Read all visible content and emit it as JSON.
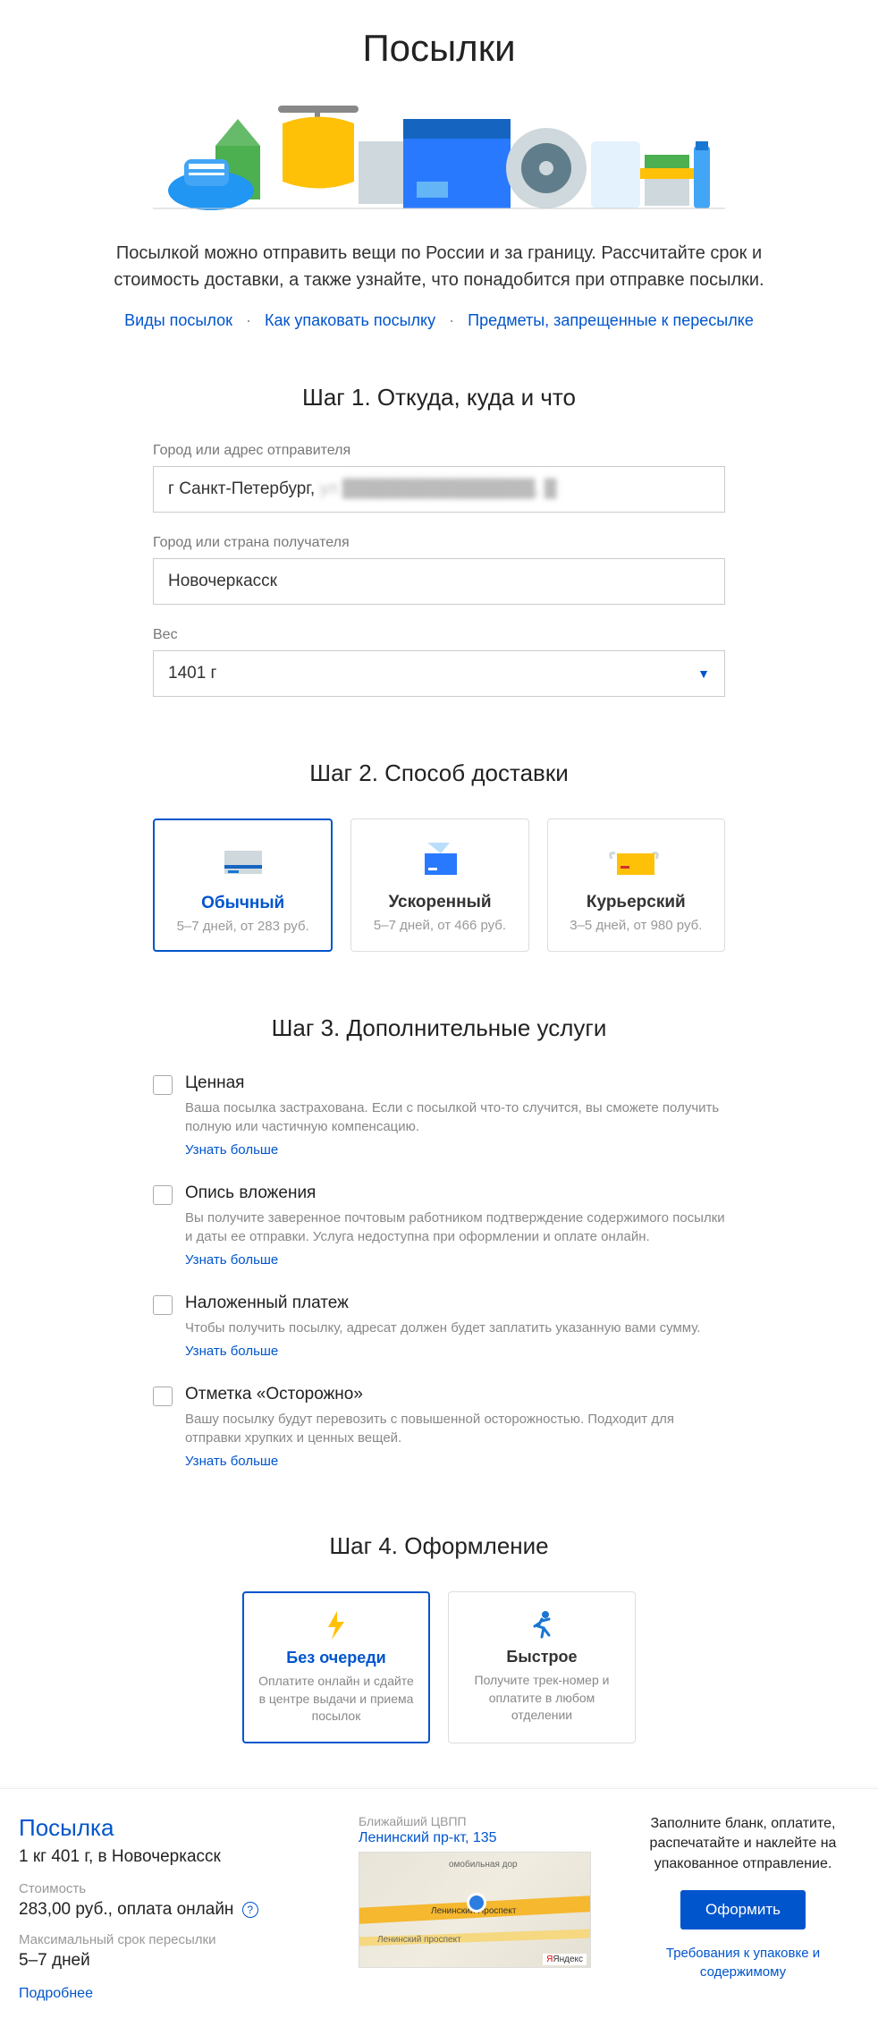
{
  "title": "Посылки",
  "intro": "Посылкой можно отправить вещи по России и за границу. Рассчитайте срок и стоимость доставки, а также узнайте, что понадобится при отправке посылки.",
  "links": {
    "types": "Виды посылок",
    "packing": "Как упаковать посылку",
    "forbidden": "Предметы, запрещенные к пересылке"
  },
  "step1": {
    "title": "Шаг 1. Откуда, куда и что",
    "from_label": "Город или адрес отправителя",
    "from_value": "г Санкт-Петербург, ",
    "from_redacted": "ул ████████████████, █",
    "to_label": "Город или страна получателя",
    "to_value": "Новочеркасск",
    "weight_label": "Вес",
    "weight_value": "1401 г"
  },
  "step2": {
    "title": "Шаг 2. Способ доставки",
    "options": [
      {
        "name": "Обычный",
        "sub": "5–7 дней, от 283 руб.",
        "selected": true
      },
      {
        "name": "Ускоренный",
        "sub": "5–7 дней, от 466 руб.",
        "selected": false
      },
      {
        "name": "Курьерский",
        "sub": "3–5 дней, от 980 руб.",
        "selected": false
      }
    ]
  },
  "step3": {
    "title": "Шаг 3. Дополнительные услуги",
    "items": [
      {
        "title": "Ценная",
        "desc": "Ваша посылка застрахована. Если с посылкой что-то случится, вы сможете получить полную или частичную компенсацию.",
        "link": "Узнать больше"
      },
      {
        "title": "Опись вложения",
        "desc": "Вы получите заверенное почтовым работником подтверждение содержимого посылки и даты ее отправки. Услуга недоступна при оформлении и оплате онлайн.",
        "link": "Узнать больше"
      },
      {
        "title": "Наложенный платеж",
        "desc": "Чтобы получить посылку, адресат должен будет заплатить указанную вами сумму.",
        "link": "Узнать больше"
      },
      {
        "title": "Отметка «Осторожно»",
        "desc": "Вашу посылку будут перевозить с повышенной осторожностью. Подходит для отправки хрупких и ценных вещей.",
        "link": "Узнать больше"
      }
    ]
  },
  "step4": {
    "title": "Шаг 4. Оформление",
    "options": [
      {
        "title": "Без очереди",
        "sub": "Оплатите онлайн и сдайте в центре выдачи и приема посылок",
        "selected": true
      },
      {
        "title": "Быстрое",
        "sub": "Получите трек-номер и оплатите в любом отделении",
        "selected": false
      }
    ]
  },
  "summary": {
    "heading": "Посылка",
    "line1": "1 кг 401 г, в Новочеркасск",
    "cost_label": "Стоимость",
    "cost_value": "283,00 руб., оплата онлайн",
    "time_label": "Максимальный срок пересылки",
    "time_value": "5–7 дней",
    "more": "Подробнее",
    "map_label": "Ближайший ЦВПП",
    "map_addr": "Ленинский пр-кт, 135",
    "map_road1": "Ленинский Проспект",
    "map_road2": "омобильная дор",
    "map_road3": "Ленинский проспект",
    "map_yandex": "Яндекс",
    "right_text": "Заполните бланк, оплатите, распечатайте и наклейте на упакованное отправление.",
    "submit": "Оформить",
    "req_link": "Требования к упаковке и содержимому"
  }
}
